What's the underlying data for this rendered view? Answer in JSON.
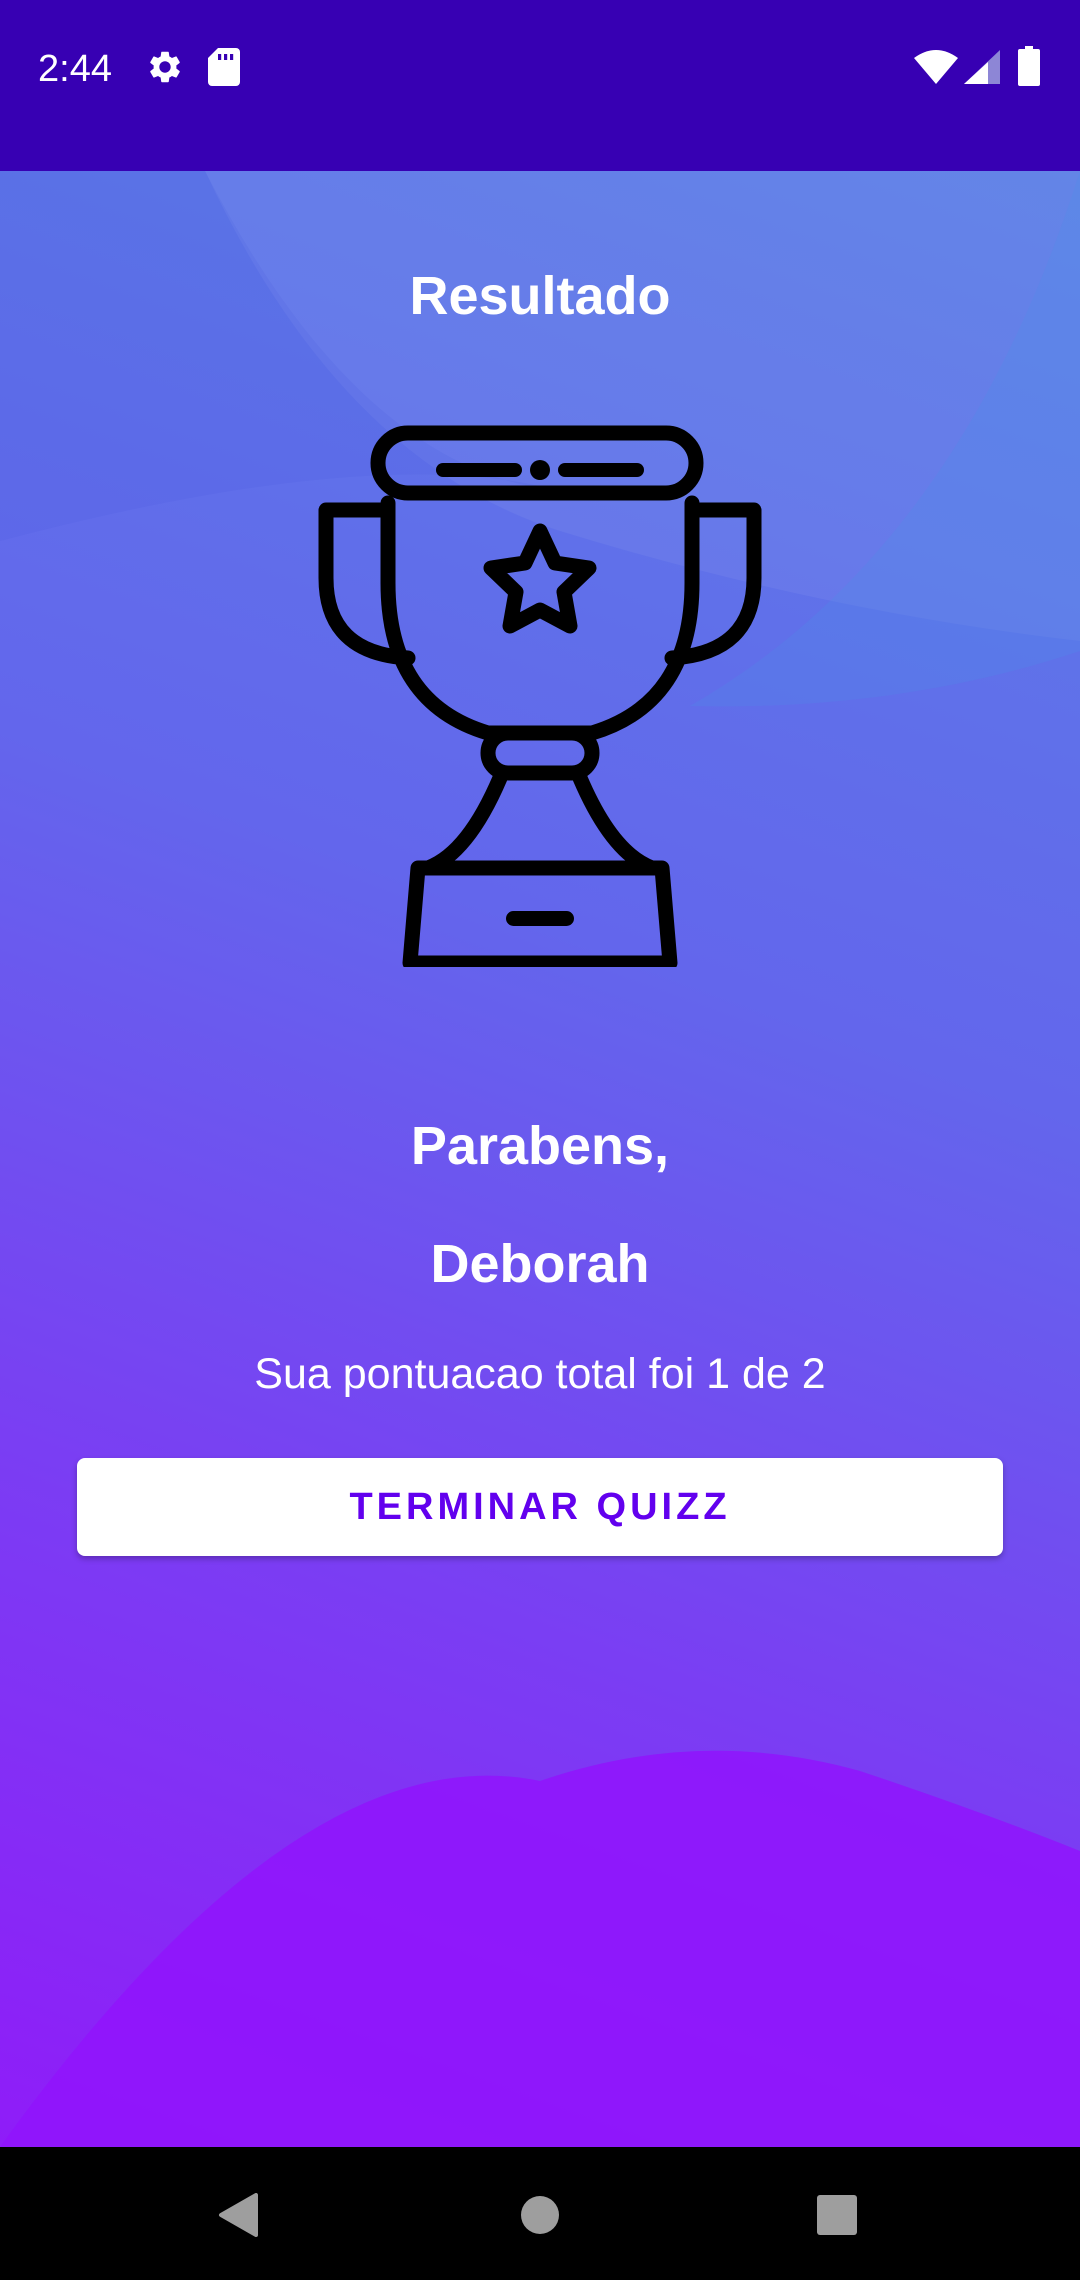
{
  "status_bar": {
    "time": "2:44",
    "icons": [
      "gear-icon",
      "sd-card-icon",
      "wifi-icon",
      "signal-icon",
      "battery-icon"
    ],
    "background_color": "#3700B3"
  },
  "screen": {
    "title": "Resultado",
    "trophy_icon": "trophy-icon",
    "congrats_line": "Parabens,",
    "user_name": "Deborah",
    "score_text": "Sua pontuacao total foi 1 de 2",
    "finish_button_label": "TERMINAR QUIZZ",
    "accent_color": "#6200EE"
  },
  "nav_bar": {
    "buttons": [
      "back-icon",
      "home-icon",
      "recents-icon"
    ]
  }
}
